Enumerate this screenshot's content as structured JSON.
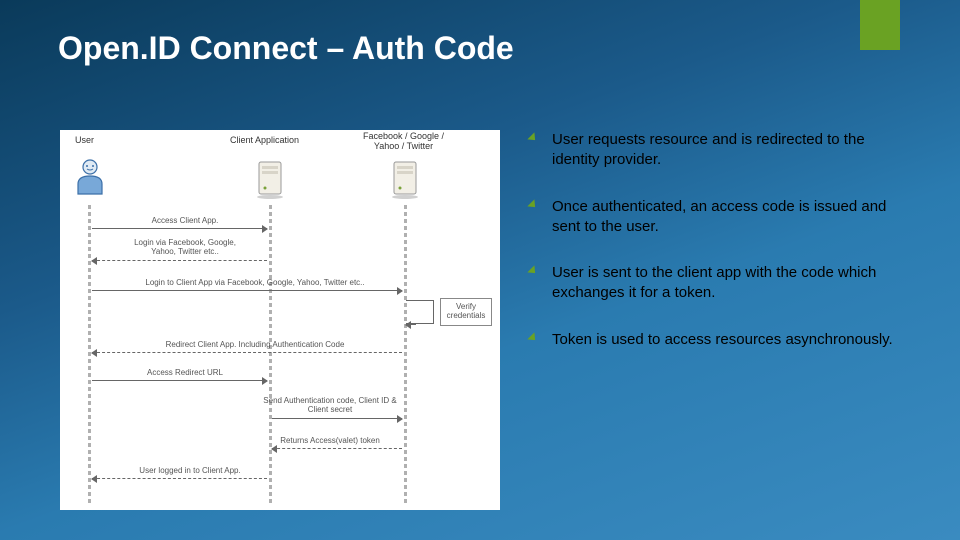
{
  "title": "Open.ID Connect – Auth Code",
  "diagram": {
    "lanes": {
      "user": "User",
      "client": "Client Application",
      "idp": "Facebook / Google /\nYahoo / Twitter"
    },
    "messages": {
      "m1": "Access Client App.",
      "m2": "Login via Facebook, Google,\nYahoo, Twitter etc..",
      "m3": "Login to Client App via Facebook, Google, Yahoo, Twitter etc..",
      "verify": "Verify\ncredentials",
      "m4": "Redirect Client App. Including Authentication Code",
      "m5": "Access Redirect URL",
      "m6": "Send Authentication code, Client ID &\nClient secret",
      "m7": "Returns Access(valet) token",
      "m8": "User logged in to Client App."
    }
  },
  "bullets": {
    "b1": "User requests resource and is redirected to the identity provider.",
    "b2": "Once authenticated, an access code is issued and sent to the user.",
    "b3": "User is sent to the client app with the code which exchanges it for a token.",
    "b4": "Token is used to access resources asynchronously."
  }
}
